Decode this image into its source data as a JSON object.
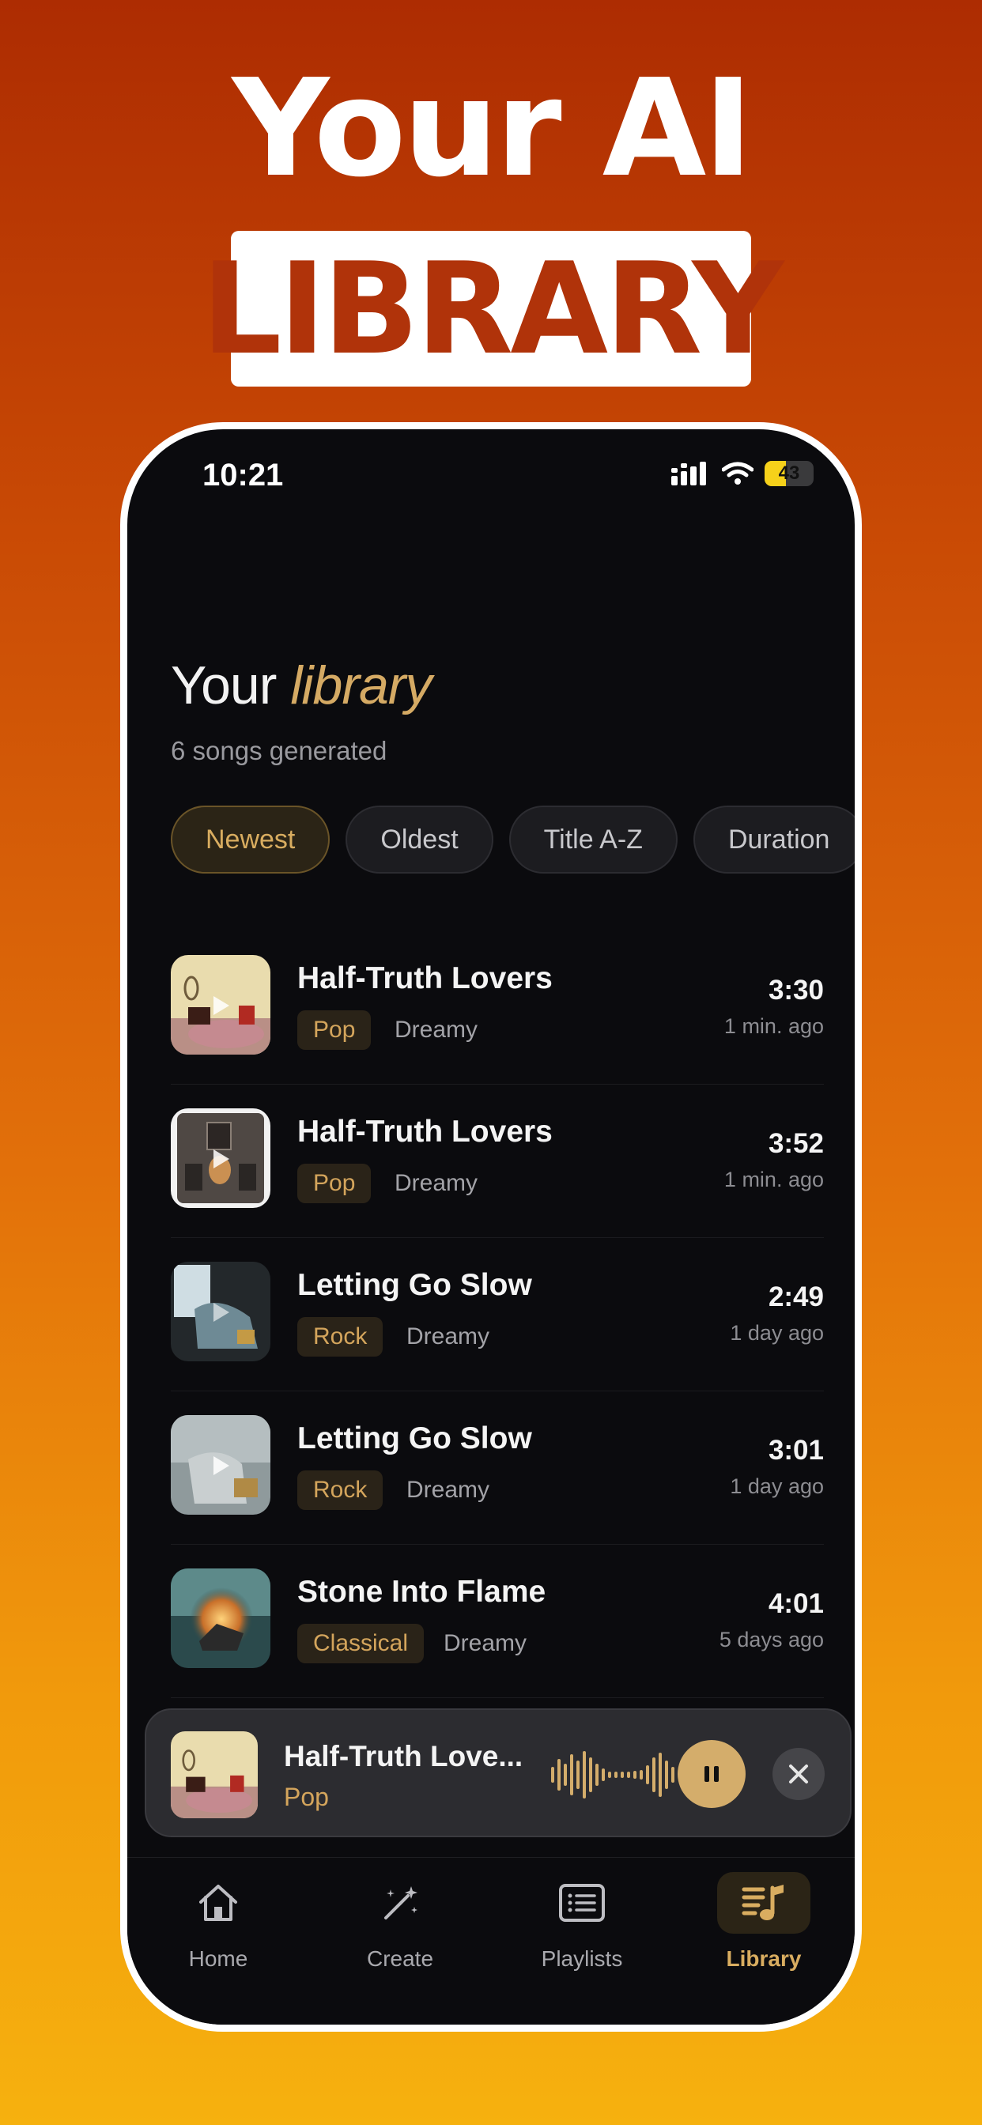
{
  "promo": {
    "headline": "Your AI",
    "highlight": "LIBRARY"
  },
  "status_bar": {
    "time": "10:21",
    "battery": "43"
  },
  "library": {
    "title_plain": "Your",
    "title_accent": "library",
    "subtitle": "6 songs generated"
  },
  "filters": [
    {
      "label": "Newest",
      "active": true
    },
    {
      "label": "Oldest",
      "active": false
    },
    {
      "label": "Title A-Z",
      "active": false
    },
    {
      "label": "Duration",
      "active": false
    }
  ],
  "songs": [
    {
      "title": "Half-Truth Lovers",
      "genre": "Pop",
      "mood": "Dreamy",
      "duration": "3:30",
      "ago": "1 min. ago"
    },
    {
      "title": "Half-Truth Lovers",
      "genre": "Pop",
      "mood": "Dreamy",
      "duration": "3:52",
      "ago": "1 min. ago"
    },
    {
      "title": "Letting Go Slow",
      "genre": "Rock",
      "mood": "Dreamy",
      "duration": "2:49",
      "ago": "1 day ago"
    },
    {
      "title": "Letting Go Slow",
      "genre": "Rock",
      "mood": "Dreamy",
      "duration": "3:01",
      "ago": "1 day ago"
    },
    {
      "title": "Stone Into Flame",
      "genre": "Classical",
      "mood": "Dreamy",
      "duration": "4:01",
      "ago": "5 days ago"
    }
  ],
  "mini_player": {
    "title": "Half-Truth Love...",
    "genre": "Pop"
  },
  "tabs": [
    {
      "label": "Home",
      "icon": "home-icon"
    },
    {
      "label": "Create",
      "icon": "magic-wand-icon"
    },
    {
      "label": "Playlists",
      "icon": "playlist-icon"
    },
    {
      "label": "Library",
      "icon": "music-library-icon",
      "active": true
    }
  ],
  "colors": {
    "accent": "#d4ad6b",
    "background": "#0b0b0e",
    "brand_orange": "#b0330a"
  }
}
